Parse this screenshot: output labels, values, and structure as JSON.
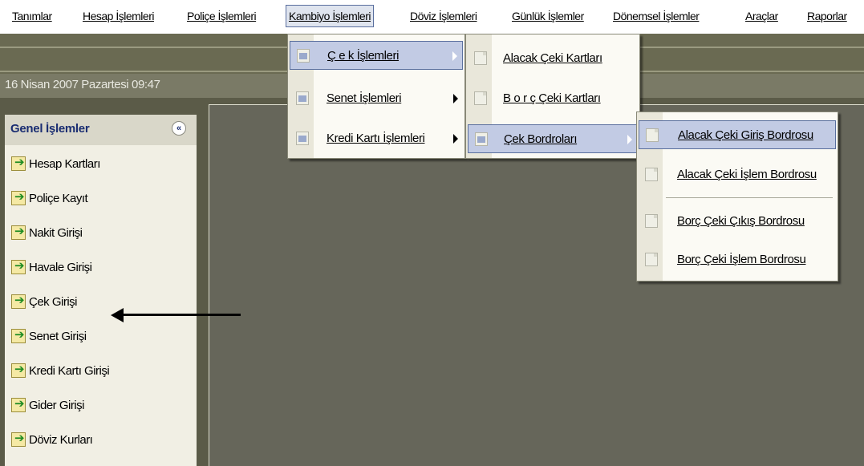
{
  "menubar": {
    "items": [
      {
        "label": "Tanımlar"
      },
      {
        "label": "Hesap İşlemleri"
      },
      {
        "label": "Poliçe İşlemleri"
      },
      {
        "label": "Kambiyo İşlemleri"
      },
      {
        "label": "Döviz İşlemleri"
      },
      {
        "label": "Günlük İşlemler"
      },
      {
        "label": "Dönemsel İşlemler"
      },
      {
        "label": "Araçlar"
      },
      {
        "label": "Raporlar"
      }
    ]
  },
  "status": {
    "date": "16 Nisan 2007 Pazartesi 09:47"
  },
  "panel": {
    "title": "Genel İşlemler",
    "collapse_glyph": "«",
    "items": [
      {
        "label": "Hesap Kartları"
      },
      {
        "label": "Poliçe Kayıt"
      },
      {
        "label": "Nakit Girişi"
      },
      {
        "label": "Havale Girişi"
      },
      {
        "label": "Çek Girişi"
      },
      {
        "label": "Senet Girişi"
      },
      {
        "label": "Kredi Kartı Girişi"
      },
      {
        "label": "Gider Girişi"
      },
      {
        "label": "Döviz Kurları"
      }
    ]
  },
  "menu_kambiyo": {
    "items": [
      {
        "label": "Ç e k  İşlemleri"
      },
      {
        "label": "Senet İşlemleri"
      },
      {
        "label": "Kredi  Kartı İşlemleri"
      }
    ]
  },
  "menu_cek": {
    "items": [
      {
        "label": "Alacak Çeki Kartları"
      },
      {
        "label": "B o r ç  Çeki Kartları"
      },
      {
        "label": "Çek Bordroları"
      }
    ]
  },
  "menu_bordro": {
    "items": [
      {
        "label": "Alacak Çeki Giriş Bordrosu"
      },
      {
        "label": "Alacak Çeki İşlem Bordrosu"
      },
      {
        "label": "Borç Çeki Çıkış Bordrosu"
      },
      {
        "label": "Borç Çeki İşlem Bordrosu"
      }
    ]
  },
  "colors": {
    "highlight": "#c2cbe4",
    "panel_title": "#1b2e72",
    "background": "#66665a"
  }
}
